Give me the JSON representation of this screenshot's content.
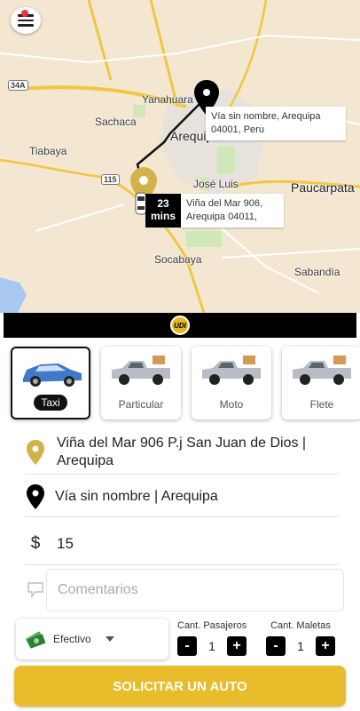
{
  "map": {
    "labels": {
      "yanahuara": "Yanahuara",
      "sachaca": "Sachaca",
      "tiabaya": "Tiabaya",
      "arequipa": "Arequipa",
      "jose_luis": "José Luis",
      "paucarpata": "Paucarpata",
      "socabaya": "Socabaya",
      "sabandia": "Sabandía"
    },
    "shields": {
      "route_34a": "34A",
      "route_115": "115"
    },
    "destination_info": "Vía sin nombre, Arequipa 04001, Peru",
    "origin_info": "Viña del Mar 906, Arequipa 04011,",
    "eta": {
      "value": "23",
      "unit": "mins"
    }
  },
  "brand": {
    "logo_text": "UDI"
  },
  "vehicles": [
    {
      "label": "Taxi",
      "selected": true
    },
    {
      "label": "Particular",
      "selected": false
    },
    {
      "label": "Moto",
      "selected": false
    },
    {
      "label": "Flete",
      "selected": false
    }
  ],
  "trip": {
    "origin": "Viña del Mar 906 P.j San Juan de Dios | Arequipa",
    "destination": "Vía sin nombre  | Arequipa",
    "currency": "$",
    "fare": "15",
    "comments_placeholder": "Comentarios"
  },
  "payment": {
    "method": "Efectivo"
  },
  "passengers": {
    "label": "Cant. Pasajeros",
    "value": "1",
    "minus": "-",
    "plus": "+"
  },
  "luggage": {
    "label": "Cant. Maletas",
    "value": "1",
    "minus": "-",
    "plus": "+"
  },
  "actions": {
    "request": "SOLICITAR UN AUTO"
  },
  "colors": {
    "accent": "#e8bc2a",
    "marker": "#d2b24a",
    "dark": "#000000"
  }
}
